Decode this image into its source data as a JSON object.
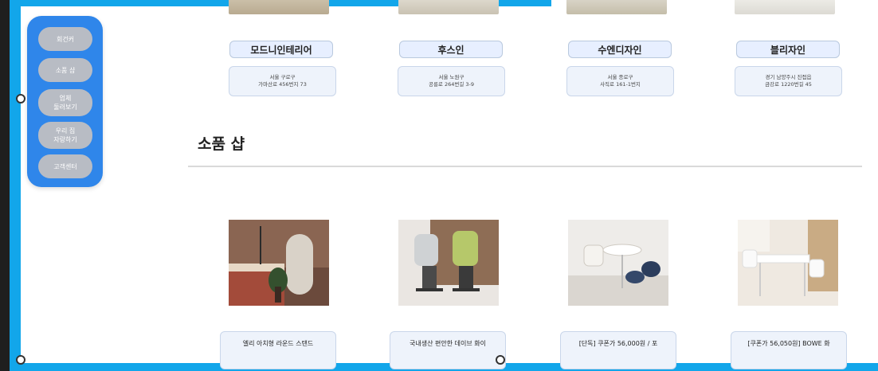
{
  "side_menu": {
    "items": [
      {
        "label": "회건커"
      },
      {
        "label": "소품 샵"
      },
      {
        "label": "업체\n둘러보기"
      },
      {
        "label": "우리 집\n자랑하기"
      },
      {
        "label": "고객센터"
      }
    ]
  },
  "stores": [
    {
      "name": "모드니인테리어",
      "address": "서울 구로구\n가마산로 456번지 73"
    },
    {
      "name": "후스인",
      "address": "서울 노원구\n공릉로 264번길 3-9"
    },
    {
      "name": "수엔디자인",
      "address": "서울 종로구\n사직로 161-1번지"
    },
    {
      "name": "블리자인",
      "address": "경기 남양주시 진접읍\n금강로 1220번길 45"
    }
  ],
  "section": {
    "title": "소품 샵"
  },
  "products": [
    {
      "title_line1": "엘리 아치형 라운드 스탠드"
    },
    {
      "title_line1": "국내생산 편안한 데이브 화이"
    },
    {
      "title_line1": "[단독] 쿠폰가 56,000원 / 포"
    },
    {
      "title_line1": "[쿠폰가 56,050원] BOWE 화"
    }
  ],
  "colors": {
    "frame_blue": "#12a6ea",
    "menu_blue": "#2f86ea",
    "pill_gray": "#b8bcc4",
    "card_bg": "#eef3fb"
  }
}
